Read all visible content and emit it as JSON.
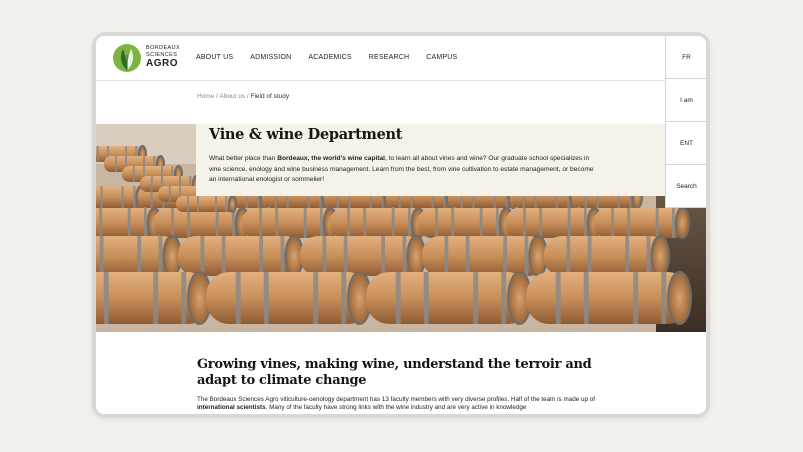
{
  "logo": {
    "line1": "BORDEAUX",
    "line2": "SCIENCES",
    "line3": "AGRO",
    "icon": "leaf-logo-icon",
    "colors": {
      "dark_green": "#2e6b2a",
      "light_green": "#7cb342"
    }
  },
  "nav": {
    "items": [
      "ABOUT US",
      "ADMISSION",
      "ACADEMICS",
      "RESEARCH",
      "CAMPUS"
    ]
  },
  "rail": {
    "items": [
      "FR",
      "I am",
      "ENT",
      "Search"
    ]
  },
  "breadcrumb": {
    "home": "Home",
    "sep1": " / ",
    "about": "About us",
    "sep2": " / ",
    "current": "Field of study"
  },
  "hero": {
    "title": "Vine & wine Department",
    "desc_pre": "What better place than ",
    "desc_bold": "Bordeaux, the world's wine capital",
    "desc_post": ", to learn all about vines and wine? Our graduate school specializes in vine science, enology and wine business management. Learn from the best, from vine cultivation to estate management, or become an international enologist or sommelier!",
    "image": "wine-barrels-cellar"
  },
  "section": {
    "title": "Growing vines, making wine, understand the terroir and adapt to climate change",
    "body_pre": "The Bordeaux Sciences Agro viticulture-oenology department has 13 faculty members with very diverse profiles. Half of the team is made up of ",
    "body_bold": "international scientists",
    "body_post": ". Many of the faculty have strong links with the wine industry and are very active in knowledge"
  },
  "colors": {
    "page_bg": "#f3f1ec",
    "card_bg": "#f5f2ea",
    "barrel_wood": "#c98f5a",
    "barrel_hoop": "#8a8a88"
  }
}
